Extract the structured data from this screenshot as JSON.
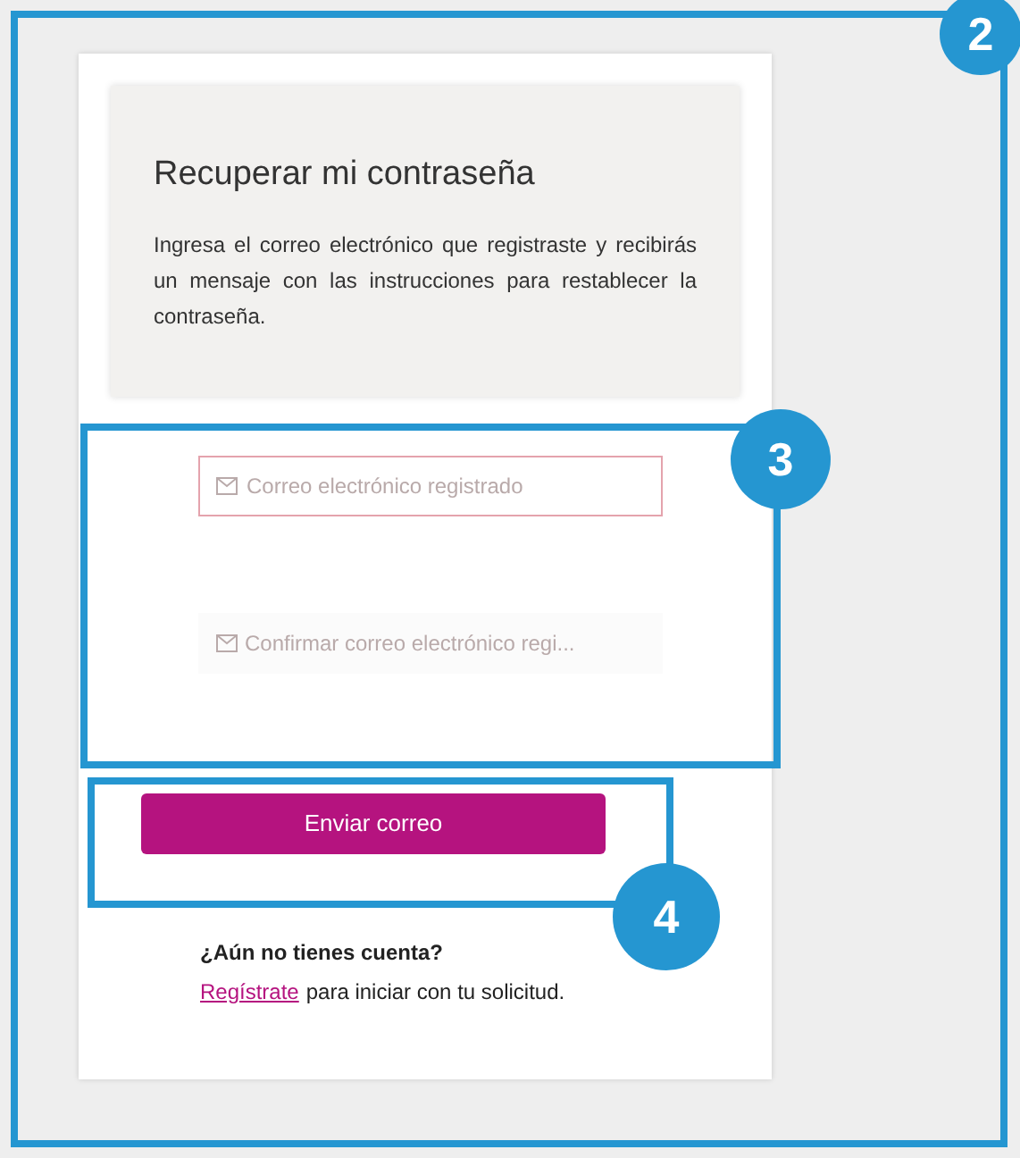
{
  "header": {
    "title": "Recuperar mi contraseña",
    "description": "Ingresa el correo electrónico que registraste y recibirás un mensaje con las instrucciones para restablecer la contraseña."
  },
  "fields": [
    {
      "placeholder": "Correo electrónico registrado",
      "error": true
    },
    {
      "placeholder": "Confirmar correo electrónico regi...",
      "error": false
    }
  ],
  "submit_button": "Enviar correo",
  "signup": {
    "question": "¿Aún no tienes cuenta?",
    "link": "Regístrate",
    "rest": "para iniciar con tu solicitud."
  },
  "callouts": [
    "2",
    "3",
    "4"
  ]
}
